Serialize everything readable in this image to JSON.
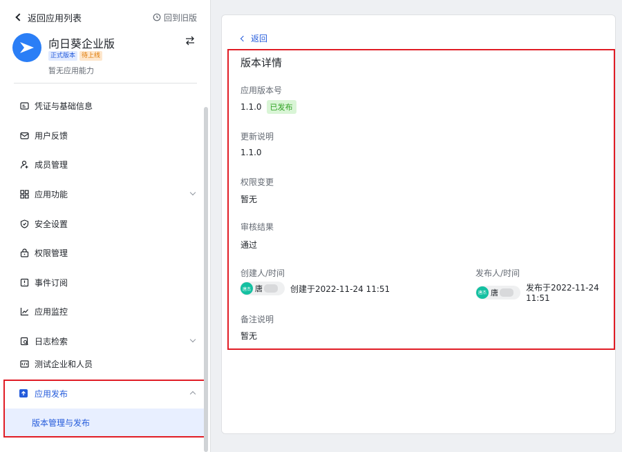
{
  "sidebar": {
    "back_label": "返回应用列表",
    "old_version_label": "回到旧版",
    "app": {
      "name": "向日葵企业版",
      "badge_official": "正式版本",
      "badge_pending": "待上线",
      "description": "暂无应用能力"
    },
    "items": [
      {
        "label": "凭证与基础信息",
        "icon": "id-card-icon"
      },
      {
        "label": "用户反馈",
        "icon": "mail-icon"
      },
      {
        "label": "成员管理",
        "icon": "user-add-icon"
      },
      {
        "label": "应用功能",
        "icon": "grid-icon"
      },
      {
        "label": "安全设置",
        "icon": "shield-icon"
      },
      {
        "label": "权限管理",
        "icon": "lock-icon"
      },
      {
        "label": "事件订阅",
        "icon": "event-icon"
      },
      {
        "label": "应用监控",
        "icon": "chart-icon"
      },
      {
        "label": "日志检索",
        "icon": "log-search-icon"
      },
      {
        "label": "测试企业和人员",
        "icon": "test-icon"
      }
    ],
    "publish": {
      "label": "应用发布",
      "sub_label": "版本管理与发布"
    }
  },
  "main": {
    "back_label": "返回",
    "title": "版本详情",
    "version_label": "应用版本号",
    "version_value": "1.1.0",
    "version_status": "已发布",
    "update_label": "更新说明",
    "update_value": "1.1.0",
    "permission_label": "权限变更",
    "permission_value": "暂无",
    "review_label": "审核结果",
    "review_value": "通过",
    "creator_label": "创建人/时间",
    "creator_avatar": "唐杰",
    "creator_name": "唐",
    "creator_time": "创建于2022-11-24 11:51",
    "publisher_label": "发布人/时间",
    "publisher_avatar": "唐杰",
    "publisher_name": "唐",
    "publisher_time": "发布于2022-11-24 11:51",
    "remark_label": "备注说明",
    "remark_value": "暂无"
  },
  "colors": {
    "accent": "#245bdb",
    "highlight_border": "#e01b24",
    "success": "#2ea121"
  }
}
